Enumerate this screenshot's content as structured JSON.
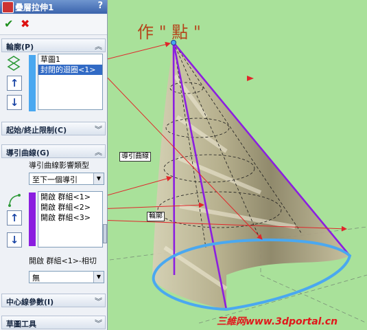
{
  "feature_title": "疊層拉伸1",
  "help_label": "?",
  "ok_label": "✔",
  "cancel_label": "✖",
  "profiles_section": {
    "title": "輪廓(P)",
    "items": [
      "草圖1",
      "封閉的迴圈<1>"
    ]
  },
  "start_end_section": {
    "title": "起始/終止限制(C)"
  },
  "guide_section": {
    "title": "導引曲線(G)",
    "influence_label": "導引曲線影響類型",
    "influence_value": "至下一個導引",
    "items": [
      "開啟 群組<1>",
      "開啟 群組<2>",
      "開啟 群組<3>"
    ],
    "tangency_label": "開啟 群組<1>-相切",
    "tangency_value": "無"
  },
  "centerline_section": {
    "title": "中心線參數(I)"
  },
  "sketch_tools_section": {
    "title": "草圖工具"
  },
  "annotations": {
    "point_note": "作 \" 點 \"",
    "guide_source_label": "導引曲線",
    "profile_label": "輪廓"
  },
  "watermark": "三維网www.3dportal.cn",
  "colors": {
    "background": "#a9e19a",
    "profile_blue": "#4aa8f0",
    "guide_purple": "#8b1ee0",
    "arrow_red": "#e0262a",
    "annotation_brown": "#b5451b"
  }
}
